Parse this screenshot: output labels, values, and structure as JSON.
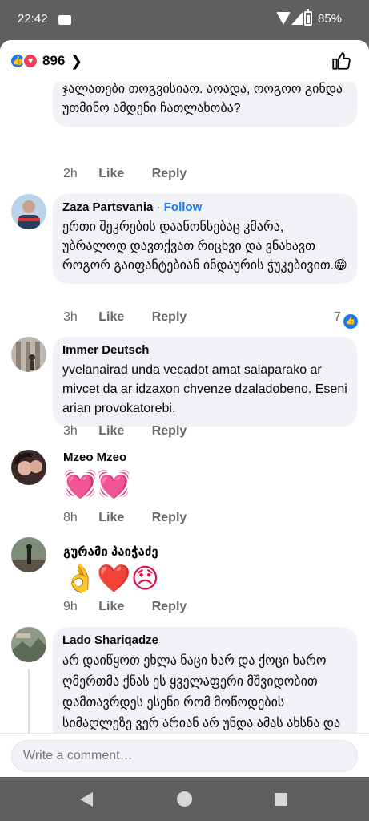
{
  "status_bar": {
    "time": "22:42",
    "battery": "85%"
  },
  "header": {
    "reaction_count": "896"
  },
  "comments": [
    {
      "text": "ჯალათები თოგვისიაო. აოადა, ოოგოო გინდა უთმინო ამდენი ჩათლახობა?",
      "time": "2h",
      "like": "Like",
      "reply": "Reply"
    },
    {
      "author": "Zaza Partsvania",
      "follow": "Follow",
      "text": "ერთი შეკრების დაანონსებაც კმარა, უბრალოდ დავთქვათ რიცხვი და ვნახავთ როგორ გაიფანტებიან ინდაურის ჭუკებივით.😁",
      "time": "3h",
      "like": "Like",
      "reply": "Reply",
      "likes": "7"
    },
    {
      "author": "Immer Deutsch",
      "text": "yvelanairad unda vecadot amat salaparako ar mivcet da ar idzaxon chvenze dzaladobeno. Eseni arian provokatorebi.",
      "time": "3h",
      "like": "Like",
      "reply": "Reply"
    },
    {
      "author": "Mzeo Mzeo",
      "text": "💓💓",
      "time": "8h",
      "like": "Like",
      "reply": "Reply"
    },
    {
      "author": "გურამი პაიჭაძე",
      "text": "👌❤️😞",
      "time": "9h",
      "like": "Like",
      "reply": "Reply"
    },
    {
      "author": "Lado Shariqadze",
      "text": "არ დაიწყოთ ეხლა ნაცი ხარ და ქოცი ხარო  ღმერთმა ქნას ეს ყველაფერი მშვიდობით დამთავრდეს  ესენი რომ მოწოდების სიმაღლეზე ვერ არიან არ უნდა ამას ახსნა და განმარტება  ისინი რომ ყველაფერზე წამსვლელები"
    }
  ],
  "composer": {
    "placeholder": "Write a comment…"
  },
  "colors": {
    "accent": "#1877f2",
    "love": "#f33e58",
    "bubble": "#f0f2f5",
    "meta": "#65676b"
  }
}
